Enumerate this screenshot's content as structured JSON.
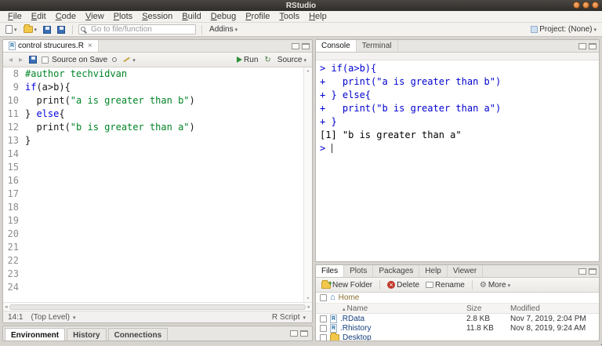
{
  "titlebar": {
    "title": "RStudio"
  },
  "menubar": {
    "items": [
      "File",
      "Edit",
      "Code",
      "View",
      "Plots",
      "Session",
      "Build",
      "Debug",
      "Profile",
      "Tools",
      "Help"
    ]
  },
  "main_toolbar": {
    "goto_placeholder": "Go to file/function",
    "addins_label": "Addins",
    "project_label": "Project: (None)"
  },
  "source_pane": {
    "tab_title": "control strucures.R",
    "source_on_save_label": "Source on Save",
    "run_label": "Run",
    "source_label": "Source",
    "status_position": "14:1",
    "status_scope": "(Top Level)",
    "status_filetype": "R Script"
  },
  "editor": {
    "lines": [
      {
        "n": "8",
        "segs": [
          {
            "t": "#author techvidvan",
            "c": "comment"
          }
        ]
      },
      {
        "n": "9",
        "segs": [
          {
            "t": "if",
            "c": "keyword"
          },
          {
            "t": "(a>b){",
            "c": "plain"
          }
        ]
      },
      {
        "n": "10",
        "segs": [
          {
            "t": "  print(",
            "c": "plain"
          },
          {
            "t": "\"a is greater than b\"",
            "c": "string"
          },
          {
            "t": ")",
            "c": "plain"
          }
        ]
      },
      {
        "n": "11",
        "segs": [
          {
            "t": "} ",
            "c": "plain"
          },
          {
            "t": "else",
            "c": "keyword"
          },
          {
            "t": "{",
            "c": "plain"
          }
        ]
      },
      {
        "n": "12",
        "segs": [
          {
            "t": "  print(",
            "c": "plain"
          },
          {
            "t": "\"b is greater than a\"",
            "c": "string"
          },
          {
            "t": ")",
            "c": "plain"
          }
        ]
      },
      {
        "n": "13",
        "segs": [
          {
            "t": "}",
            "c": "plain"
          }
        ]
      },
      {
        "n": "14",
        "segs": []
      },
      {
        "n": "15",
        "segs": []
      },
      {
        "n": "16",
        "segs": []
      },
      {
        "n": "17",
        "segs": []
      },
      {
        "n": "18",
        "segs": []
      },
      {
        "n": "19",
        "segs": []
      },
      {
        "n": "20",
        "segs": []
      },
      {
        "n": "21",
        "segs": []
      },
      {
        "n": "22",
        "segs": []
      },
      {
        "n": "23",
        "segs": []
      },
      {
        "n": "24",
        "segs": []
      }
    ]
  },
  "console_pane": {
    "tabs": [
      "Console",
      "Terminal"
    ],
    "active_tab": "Console",
    "lines": [
      {
        "t": "> if(a>b){",
        "c": "input"
      },
      {
        "t": "+   print(\"a is greater than b\")",
        "c": "input"
      },
      {
        "t": "+ } else{",
        "c": "input"
      },
      {
        "t": "+   print(\"b is greater than a\")",
        "c": "input"
      },
      {
        "t": "+ }",
        "c": "input"
      },
      {
        "t": "[1] \"b is greater than a\"",
        "c": "output"
      },
      {
        "t": "> ",
        "c": "input",
        "cursor": true
      }
    ]
  },
  "files_pane": {
    "tabs": [
      "Files",
      "Plots",
      "Packages",
      "Help",
      "Viewer"
    ],
    "active_tab": "Files",
    "toolbar": {
      "new_folder": "New Folder",
      "delete": "Delete",
      "rename": "Rename",
      "more": "More"
    },
    "breadcrumb": "Home",
    "columns": {
      "name": "Name",
      "size": "Size",
      "modified": "Modified"
    },
    "rows": [
      {
        "icon": "r-data-file-icon",
        "name": ".RData",
        "size": "2.8 KB",
        "modified": "Nov 7, 2019, 2:04 PM"
      },
      {
        "icon": "r-history-file-icon",
        "name": ".Rhistory",
        "size": "11.8 KB",
        "modified": "Nov 8, 2019, 9:24 AM"
      },
      {
        "icon": "folder-icon",
        "name": "Desktop",
        "size": "",
        "modified": ""
      }
    ]
  },
  "environment_pane": {
    "tabs": [
      "Environment",
      "History",
      "Connections"
    ],
    "active_tab": "Environment"
  },
  "colors": {
    "keyword": "#0000e0",
    "string": "#008426",
    "comment": "#008426",
    "console_input": "#0000d0",
    "console_output": "#000000",
    "file_link": "#153e7e"
  }
}
